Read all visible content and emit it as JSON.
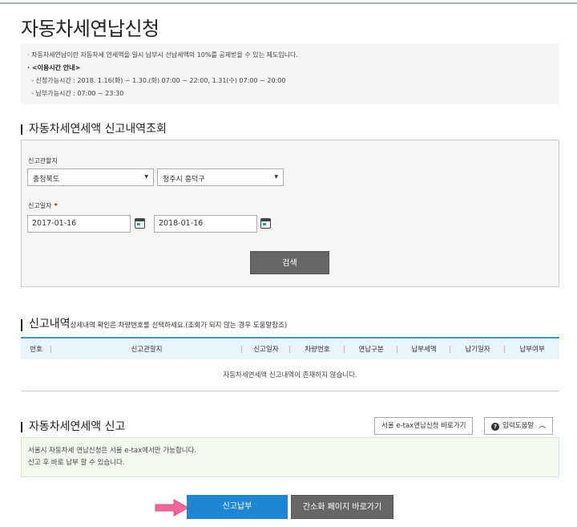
{
  "page": {
    "title": "자동차세연납신청"
  },
  "notice": {
    "line1": "· 자동차세연납이란 자동차세 연세액을 일시 납부시 선납세액의 10%를 공제받을 수 있는 제도입니다.",
    "line2": "· <이용시간 안내>",
    "line3": "  - 신청가능시간 : 2018. 1.16(화) ~ 1.30.(화) 07:00 ~ 22:00, 1.31(수) 07:00 ~ 20:00",
    "line4": "  - 납부가능시간 : 07:00 ~ 23:30"
  },
  "inquiry": {
    "section_title": "자동차세연세액 신고내역조회",
    "region_label": "신고관할지",
    "province_value": "충청북도",
    "city_value": "청주시 흥덕구",
    "date_label": "신고일자",
    "required_mark": "*",
    "date_from": "2017-01-16",
    "date_to": "2018-01-16",
    "search_button": "검색"
  },
  "history": {
    "section_title": "신고내역",
    "section_sub": "상세내역 확인은 차량번호를 선택하세요.(조회가 되지 않는 경우 도움말참조)",
    "columns": [
      "번호",
      "신고관할지",
      "신고일자",
      "차량번호",
      "연납구분",
      "납부세액",
      "납기일자",
      "납부여부"
    ],
    "empty_message": "자동차세연세액 신고내역이 존재하지 않습니다."
  },
  "report": {
    "section_title": "자동차세연세액 신고",
    "etax_button": "서울 e-tax연납신청 바로가기",
    "help_button": "입력도움말",
    "info_line1": "서울시 자동차세 연납신청은 서울 e-tax에서만 가능합니다.",
    "info_line2": "신고 후 바로 납부 할 수 있습니다."
  },
  "actions": {
    "submit_button": "신고납부",
    "simple_page_button": "간소화 페이지 바로가기"
  },
  "colors": {
    "primary_blue": "#1f86d6",
    "dark_button": "#666666",
    "pointer_pink": "#f0679a"
  }
}
